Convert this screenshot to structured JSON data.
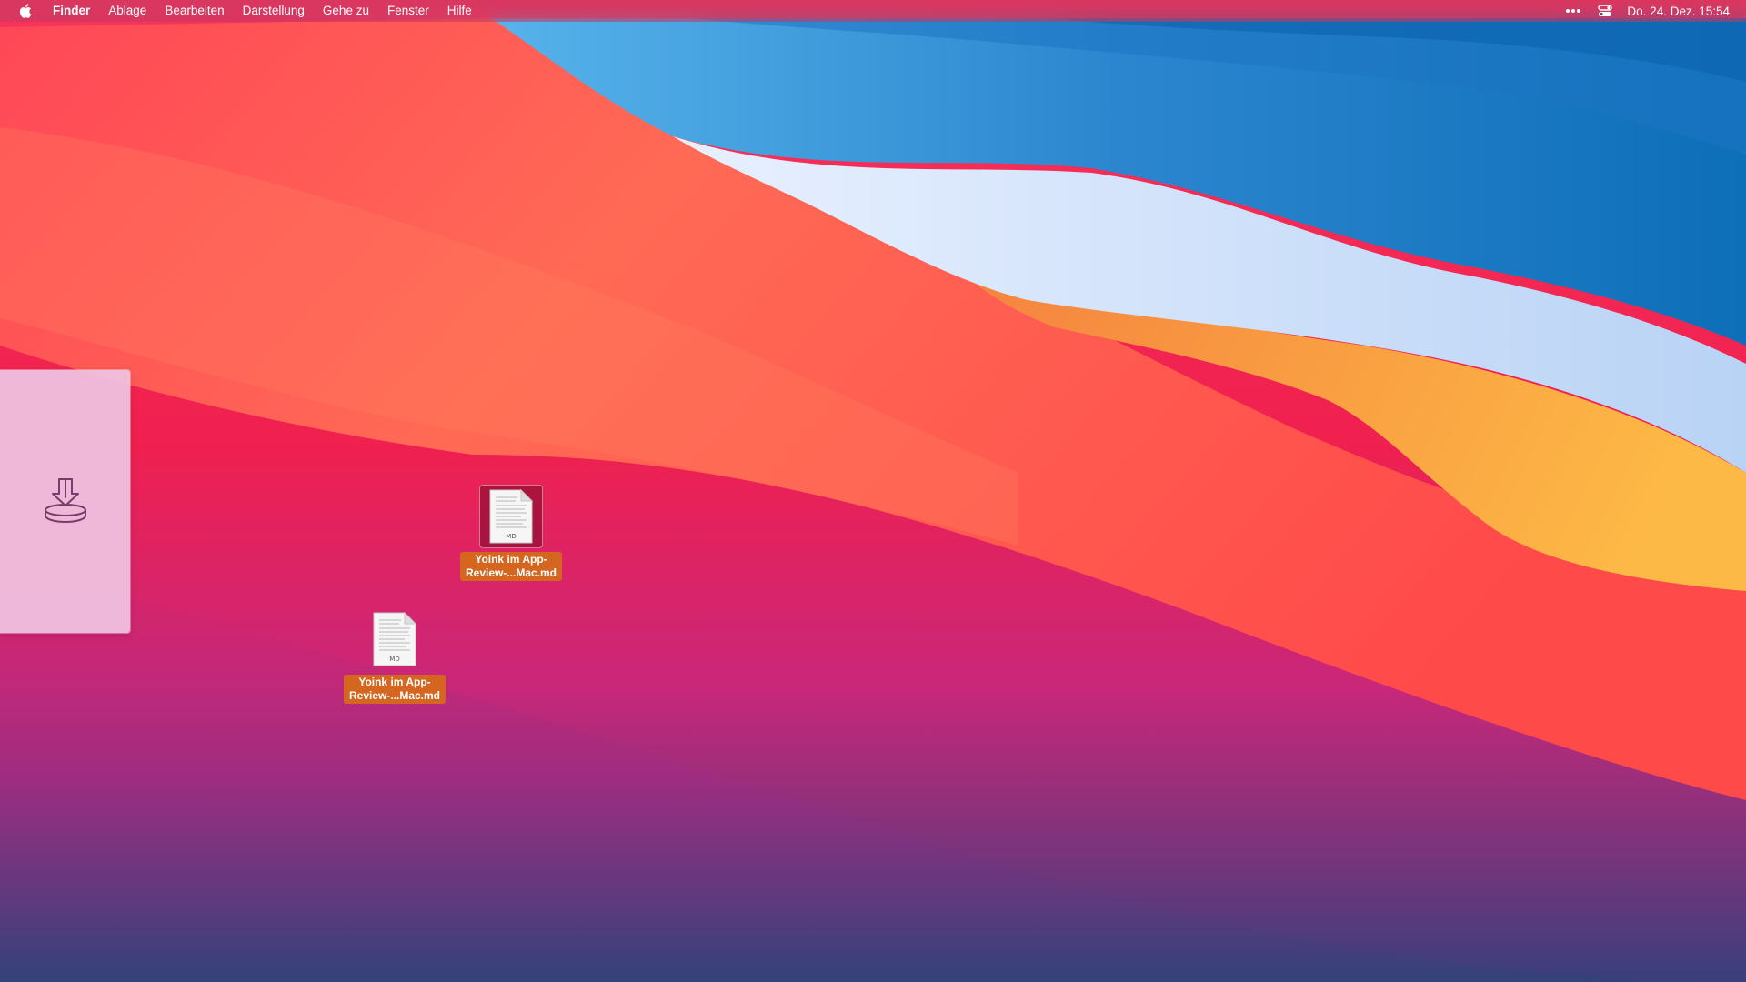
{
  "menubar": {
    "apple_icon": "apple-logo-icon",
    "items": [
      {
        "label": "Finder"
      },
      {
        "label": "Ablage"
      },
      {
        "label": "Bearbeiten"
      },
      {
        "label": "Darstellung"
      },
      {
        "label": "Gehe zu"
      },
      {
        "label": "Fenster"
      },
      {
        "label": "Hilfe"
      }
    ],
    "status": {
      "overflow_icon": "more-dots-icon",
      "control_center_icon": "control-center-icon",
      "clock": "Do. 24. Dez.  15:54"
    }
  },
  "shelf": {
    "icon": "tray-download-icon"
  },
  "desktop_icons": [
    {
      "name_line1": "Yoink im App-",
      "name_line2": "Review-...Mac.md",
      "badge": "MD",
      "selected": true
    },
    {
      "name_line1": "Yoink im App-",
      "name_line2": "Review-...Mac.md",
      "badge": "MD",
      "selected": false
    }
  ],
  "colors": {
    "label_highlight": "#d4661f",
    "shelf_background": "#f0c4e2"
  }
}
